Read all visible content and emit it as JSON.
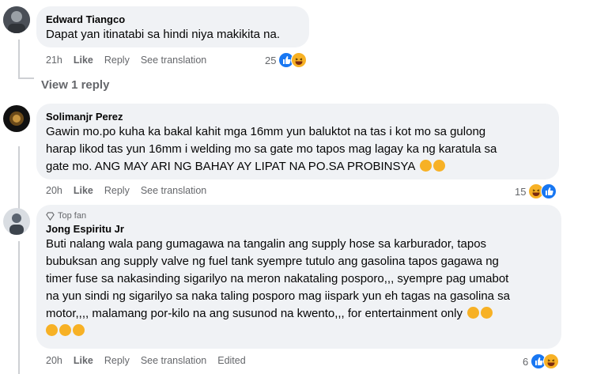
{
  "comments": [
    {
      "author": "Edward Tiangco",
      "text": "Dapat yan itinatabi sa hindi niya makikita na.",
      "time": "21h",
      "like": "Like",
      "reply": "Reply",
      "translate": "See translation",
      "reaction_count": "25",
      "reactions": [
        "like-icon",
        "haha-icon"
      ]
    },
    {
      "author": "Solimanjr Perez",
      "text_lines": [
        "Gawin mo.po kuha ka bakal kahit mga 16mm yun baluktot na tas i kot mo sa gulong",
        "harap likod tas yun 16mm i welding mo sa gate mo tapos mag lagay ka ng karatula sa",
        "gate mo. ANG MAY ARI NG BAHAY AY LIPAT NA PO.SA PROBINSYA"
      ],
      "time": "20h",
      "like": "Like",
      "reply": "Reply",
      "translate": "See translation",
      "reaction_count": "15",
      "reactions": [
        "haha-icon",
        "like-icon"
      ]
    },
    {
      "badge": "Top fan",
      "author": "Jong Espiritu Jr",
      "text_lines": [
        "Buti nalang wala pang gumagawa na tangalin ang supply hose sa karburador, tapos",
        "bubuksan ang supply valve ng fuel tank syempre tutulo ang gasolina tapos gagawa ng",
        "timer fuse sa nakasinding sigarilyo na meron nakataling posporo,,, syempre pag umabot",
        "na yun sindi ng sigarilyo sa naka taling posporo mag iispark yun eh tagas na gasolina sa",
        "motor,,,, malamang por-kilo na ang susunod na kwento,,, for entertainment only"
      ],
      "time": "20h",
      "like": "Like",
      "reply": "Reply",
      "translate": "See translation",
      "edited": "Edited",
      "reaction_count": "6",
      "reactions": [
        "like-icon",
        "haha-icon"
      ]
    }
  ],
  "view_replies": "View 1 reply",
  "colors": {
    "bubble": "#f0f2f5",
    "meta": "#65676b",
    "like_blue": "#1877f2",
    "haha_yellow": "#f7b125"
  }
}
